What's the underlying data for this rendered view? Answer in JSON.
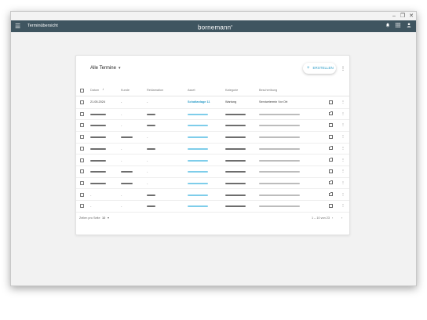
{
  "window": {
    "controls": {
      "minimize": "–",
      "maximize": "❐",
      "close": "✕"
    }
  },
  "appbar": {
    "menu_icon": "☰",
    "title": "Terminübersicht",
    "logo": "bornemann",
    "logo_sup": "x",
    "bell_icon": "🔔",
    "apps_icon": "▦",
    "user_icon": "👤",
    "background": "#3f5560"
  },
  "card": {
    "title": "Alle Termine",
    "caret": "▾",
    "create_button": {
      "icon": "+",
      "label": "ERSTELLEN"
    },
    "more_icon": "⋮",
    "accent": "#2b9cc8",
    "columns": [
      "Datum",
      "Kunde",
      "Reklamation",
      "Asset",
      "Kategorie",
      "Beschreibung"
    ],
    "sort_icon": "↓",
    "rows": [
      {
        "date": "21.05.2024",
        "customer": "-",
        "complaint": "-",
        "asset": "Schaltanlage 11",
        "category": "Wartung",
        "description": "Servicetermin Vor Ort"
      }
    ],
    "dash": "-",
    "footer": {
      "rows_per_page_label": "Zeilen pro Seite",
      "rows_per_page_value": "10",
      "rows_per_page_caret": "▾",
      "range": "1 – 10 von 23",
      "prev_icon": "‹",
      "next_icon": "›"
    }
  }
}
